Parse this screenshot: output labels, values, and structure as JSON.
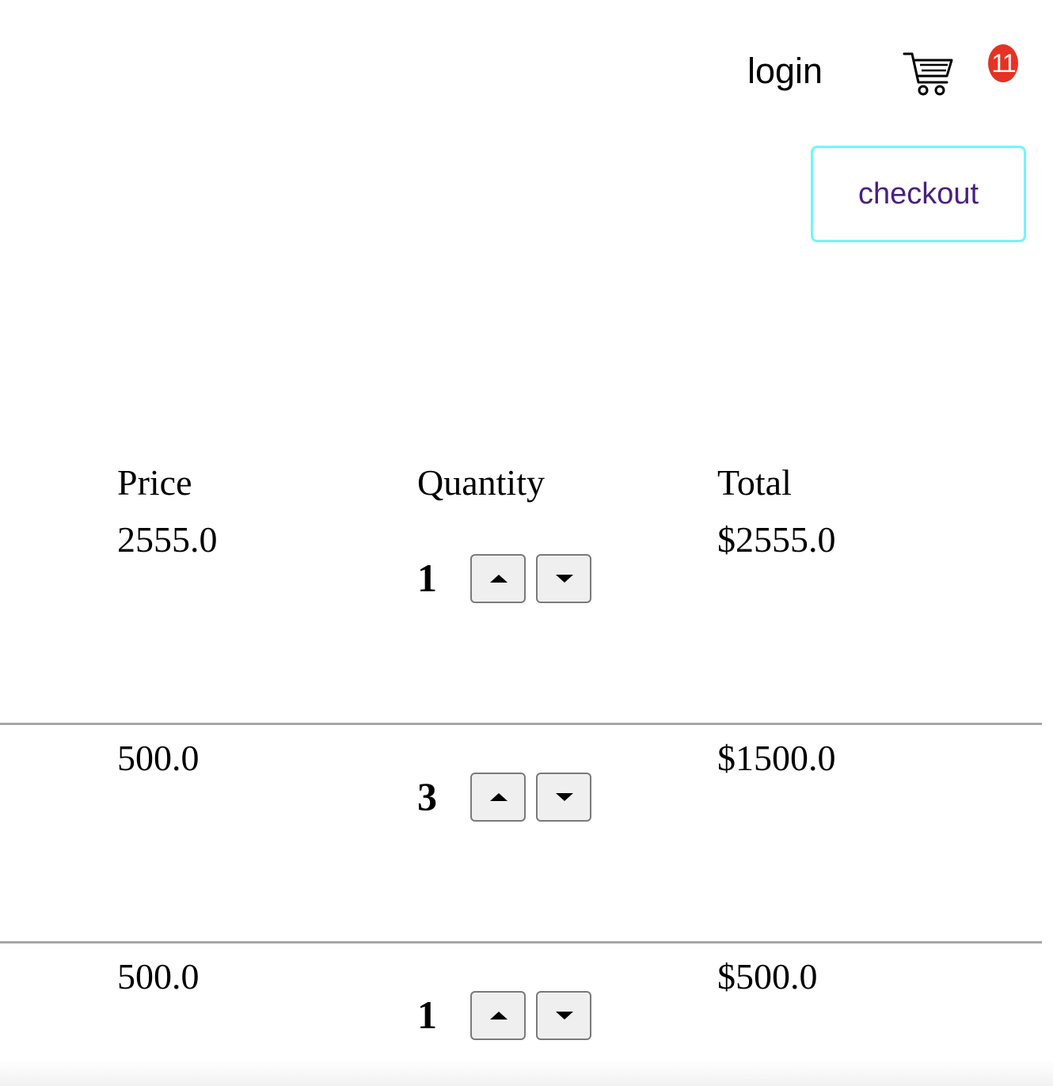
{
  "header": {
    "login_label": "login",
    "cart_count": "11",
    "cart_icon": "shopping-cart-icon",
    "badge_color": "#e53224"
  },
  "actions": {
    "checkout_label": "checkout",
    "checkout_border_color": "#6ff7fb",
    "checkout_text_color": "#4a2080"
  },
  "table": {
    "columns": [
      "Price",
      "Quantity",
      "Total"
    ],
    "rows": [
      {
        "price": "2555.0",
        "quantity": "1",
        "total": "$2555.0"
      },
      {
        "price": "500.0",
        "quantity": "3",
        "total": "$1500.0"
      },
      {
        "price": "500.0",
        "quantity": "1",
        "total": "$500.0"
      }
    ],
    "stepper_icons": [
      "caret-up-icon",
      "caret-down-icon"
    ]
  }
}
